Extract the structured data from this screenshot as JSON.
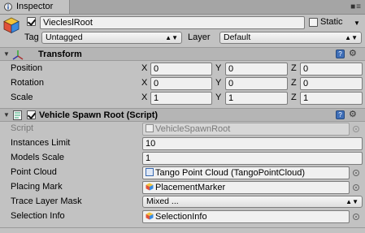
{
  "window": {
    "tab_title": "Inspector"
  },
  "header": {
    "object_name": "ViecleslRoot",
    "static_label": "Static",
    "tag_label": "Tag",
    "tag_value": "Untagged",
    "layer_label": "Layer",
    "layer_value": "Default"
  },
  "transform": {
    "title": "Transform",
    "rows": [
      {
        "label": "Position",
        "x": "0",
        "y": "0",
        "z": "0"
      },
      {
        "label": "Rotation",
        "x": "0",
        "y": "0",
        "z": "0"
      },
      {
        "label": "Scale",
        "x": "1",
        "y": "1",
        "z": "1"
      }
    ],
    "axis_x": "X",
    "axis_y": "Y",
    "axis_z": "Z"
  },
  "script_component": {
    "title": "Vehicle Spawn Root (Script)",
    "rows": [
      {
        "label": "Script",
        "value": "VehicleSpawnRoot",
        "kind": "object",
        "disabled": true
      },
      {
        "label": "Instances Limit",
        "value": "10",
        "kind": "number"
      },
      {
        "label": "Models Scale",
        "value": "1",
        "kind": "number"
      },
      {
        "label": "Point Cloud",
        "value": "Tango Point Cloud (TangoPointCloud)",
        "kind": "object"
      },
      {
        "label": "Placing Mark",
        "value": "PlacementMarker",
        "kind": "object"
      },
      {
        "label": "Trace Layer Mask",
        "value": "Mixed ...",
        "kind": "dropdown"
      },
      {
        "label": "Selection Info",
        "value": "SelectionInfo",
        "kind": "object"
      }
    ]
  },
  "colors": {
    "help_icon": "#3f6fb8",
    "panel_bg": "#c2c2c2"
  }
}
